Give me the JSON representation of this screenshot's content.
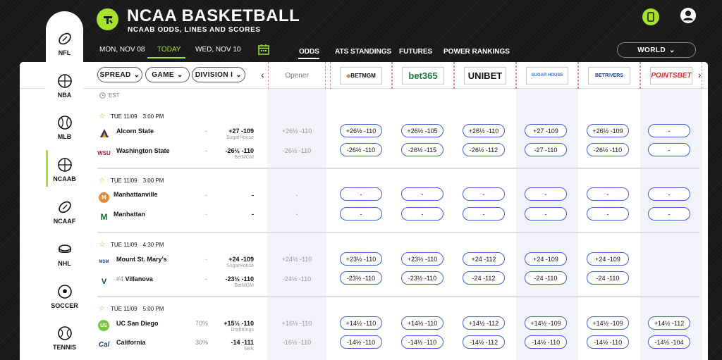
{
  "header": {
    "title": "NCAA BASKETBALL",
    "subtitle": "NCAAB ODDS, LINES AND SCORES",
    "accent": "#a6e22e"
  },
  "dates": {
    "prev": "MON, NOV 08",
    "today": "TODAY",
    "next": "WED, NOV 10"
  },
  "nav": {
    "tabs": [
      "ODDS",
      "ATS STANDINGS",
      "FUTURES",
      "POWER RANKINGS"
    ],
    "region": "WORLD"
  },
  "sidebar": {
    "items": [
      "NFL",
      "NBA",
      "MLB",
      "NCAAB",
      "NCAAF",
      "NHL",
      "SOCCER",
      "TENNIS"
    ],
    "active": "NCAAB"
  },
  "filters": {
    "spread": "SPREAD",
    "game": "GAME",
    "division": "DIVISION I"
  },
  "columns": {
    "opener": "Opener",
    "books": [
      "BETMGM",
      "bet365",
      "UNIBET",
      "SUGAR HOUSE",
      "BETRIVERS",
      "POINTSBET"
    ]
  },
  "timezone": "EST",
  "games": [
    {
      "date": "TUE 11/09",
      "time": "3:00 PM",
      "teams": [
        {
          "name": "Alcorn State",
          "icon": "A",
          "pct": "-",
          "best": "+27 -109",
          "best_book": "SugarHouse",
          "opener": "+26½ -110",
          "odds": [
            "+26½ -110",
            "+26½ -105",
            "+26½ -110",
            "+27 -109",
            "+26½ -109",
            "-"
          ]
        },
        {
          "name": "Washington State",
          "icon": "WSU",
          "pct": "-",
          "best": "-26½ -110",
          "best_book": "BetMGM",
          "opener": "-26½ -110",
          "odds": [
            "-26½ -110",
            "-26½ -115",
            "-26½ -112",
            "-27 -110",
            "-26½ -110",
            "-"
          ]
        }
      ]
    },
    {
      "date": "TUE 11/09",
      "time": "3:00 PM",
      "teams": [
        {
          "name": "Manhattanville",
          "icon": "M",
          "pct": "-",
          "best": "-",
          "best_book": "",
          "opener": "-",
          "odds": [
            "-",
            "-",
            "-",
            "-",
            "-",
            "-"
          ]
        },
        {
          "name": "Manhattan",
          "icon": "M",
          "pct": "-",
          "best": "-",
          "best_book": "",
          "opener": "-",
          "odds": [
            "-",
            "-",
            "-",
            "-",
            "-",
            "-"
          ]
        }
      ]
    },
    {
      "date": "TUE 11/09",
      "time": "4:30 PM",
      "teams": [
        {
          "name": "Mount St. Mary's",
          "icon": "MSM",
          "pct": "-",
          "best": "+24 -109",
          "best_book": "SugarHouse",
          "opener": "+24½ -110",
          "odds": [
            "+23½ -110",
            "+23½ -110",
            "+24 -112",
            "+24 -109",
            "+24 -109",
            ""
          ]
        },
        {
          "name": "Villanova",
          "rank": "#4",
          "icon": "V",
          "pct": "-",
          "best": "-23½ -110",
          "best_book": "BetMGM",
          "opener": "-24½ -110",
          "odds": [
            "-23½ -110",
            "-23½ -110",
            "-24 -112",
            "-24 -110",
            "-24 -110",
            ""
          ]
        }
      ]
    },
    {
      "date": "TUE 11/09",
      "time": "5:00 PM",
      "teams": [
        {
          "name": "UC San Diego",
          "icon": "US",
          "pct": "70%",
          "best": "+15½ -110",
          "best_book": "DraftKings",
          "opener": "+16½ -110",
          "odds": [
            "+14½ -110",
            "+14½ -110",
            "+14½ -112",
            "+14½ -109",
            "+14½ -109",
            "+14½ -112"
          ]
        },
        {
          "name": "California",
          "icon": "Cal",
          "pct": "30%",
          "best": "-14 -111",
          "best_book": "SBK",
          "opener": "-16½ -110",
          "odds": [
            "-14½ -110",
            "-14½ -110",
            "-14½ -112",
            "-14½ -110",
            "-14½ -110",
            "-14½ -104"
          ]
        }
      ]
    }
  ]
}
